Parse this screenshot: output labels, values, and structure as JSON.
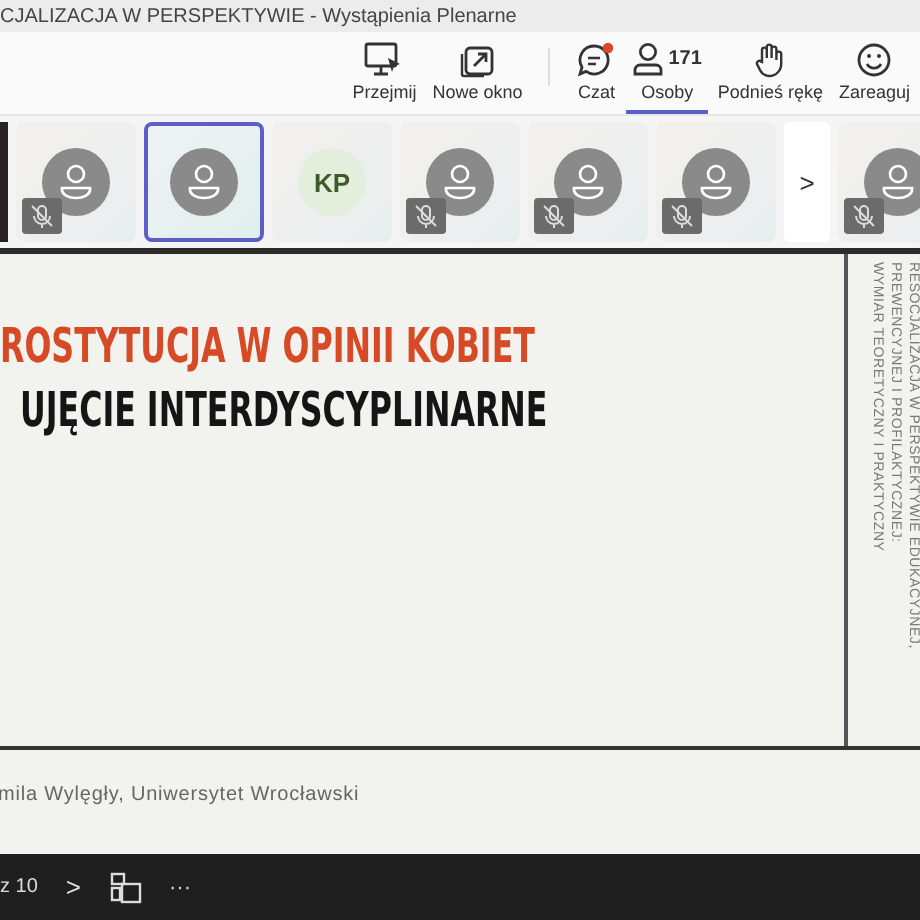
{
  "window": {
    "title": "CJALIZACJA W PERSPEKTYWIE - Wystąpienia Plenarne"
  },
  "toolbar": [
    {
      "kind": "share",
      "label": "Przejmij",
      "selected": false
    },
    {
      "kind": "popout",
      "label": "Nowe okno",
      "selected": false
    },
    {
      "kind": "divider"
    },
    {
      "kind": "chat",
      "label": "Czat",
      "selected": false,
      "unread": true
    },
    {
      "kind": "people",
      "label": "Osoby",
      "count": "171",
      "selected": true
    },
    {
      "kind": "hand",
      "label": "Podnieś rękę",
      "selected": false
    },
    {
      "kind": "react",
      "label": "Zareaguj",
      "selected": false
    }
  ],
  "participants": [
    {
      "kind": "video"
    },
    {
      "kind": "avatar",
      "muted": true,
      "selected": false
    },
    {
      "kind": "avatar",
      "muted": false,
      "selected": true
    },
    {
      "kind": "initials",
      "initials": "KP",
      "muted": false,
      "selected": false
    },
    {
      "kind": "avatar",
      "muted": true,
      "selected": false
    },
    {
      "kind": "avatar",
      "muted": true,
      "selected": false
    },
    {
      "kind": "avatar",
      "muted": true,
      "selected": false
    },
    {
      "kind": "next",
      "label": ">"
    },
    {
      "kind": "avatar",
      "muted": true,
      "selected": false
    }
  ],
  "slide": {
    "title_lines": [
      "ROSTYTUCJA W OPINII KOBIET",
      "UJĘCIE INTERDYSCYPLINARNE"
    ],
    "side_lines": [
      "RESOCJALIZACJA W PERSPEKTYWIE EDUKACYJNEJ,",
      "PREWENCYJNEJ I PROFILAKTYCZNEJ:",
      "WYMIAR TEORETYCZNY I PRAKTYCZNY"
    ],
    "author": "mila Wylęgły, Uniwersytet Wrocławski"
  },
  "controls": {
    "page": "z 10",
    "next": ">",
    "more": "···"
  }
}
